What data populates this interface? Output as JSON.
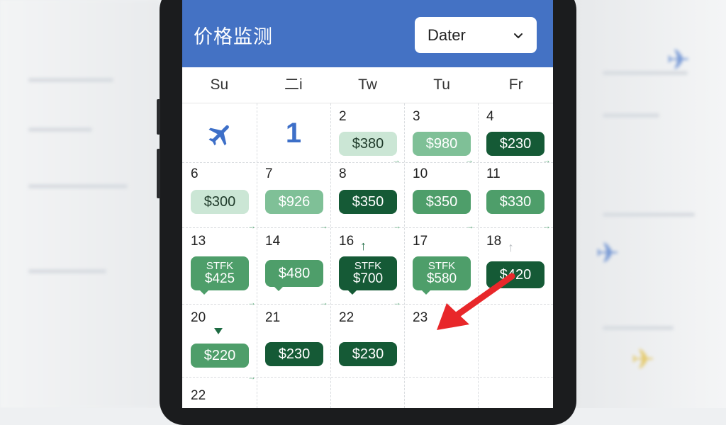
{
  "app": {
    "title": "价格监测"
  },
  "filter": {
    "selected": "Dater"
  },
  "weekdays": [
    "Su",
    "二i",
    "Tw",
    "Tu",
    "Fr"
  ],
  "row1": {
    "first_day": "1",
    "cells": [
      {
        "day": "2",
        "price": "$380",
        "level": "xlight"
      },
      {
        "day": "3",
        "price": "$980",
        "level": "light"
      },
      {
        "day": "4",
        "price": "$230",
        "level": "darker"
      }
    ]
  },
  "row2": [
    {
      "day": "6",
      "price": "$300",
      "level": "xlight"
    },
    {
      "day": "7",
      "price": "$926",
      "level": "light"
    },
    {
      "day": "8",
      "price": "$350",
      "level": "darker"
    },
    {
      "day": "10",
      "price": "$350",
      "level": "mid"
    },
    {
      "day": "11",
      "price": "$330",
      "level": "mid"
    }
  ],
  "row3": [
    {
      "day": "13",
      "sub": "STFK",
      "price": "$425",
      "level": "mid"
    },
    {
      "day": "14",
      "sub": "",
      "price": "$480",
      "level": "mid"
    },
    {
      "day": "16",
      "sub": "STFK",
      "price": "$700",
      "level": "darker"
    },
    {
      "day": "17",
      "sub": "STFK",
      "price": "$580",
      "level": "mid"
    },
    {
      "day": "18",
      "sub": "",
      "price": "$420",
      "level": "darker"
    }
  ],
  "row4": [
    {
      "day": "20",
      "price": "$220",
      "level": "mid"
    },
    {
      "day": "21",
      "price": "$230",
      "level": "darker"
    },
    {
      "day": "22",
      "price": "$230",
      "level": "darker"
    },
    {
      "day": "23",
      "price": "",
      "level": ""
    }
  ],
  "row5": {
    "day": "22"
  },
  "colors": {
    "header": "#4472c4",
    "xlight": "#cbe6d5",
    "light": "#7fc097",
    "mid": "#4e9e6a",
    "darker": "#155a36",
    "annotation_arrow": "#e8272a"
  },
  "icons": {
    "plane": "airplane-icon",
    "dropdown": "chevron-down-icon"
  }
}
